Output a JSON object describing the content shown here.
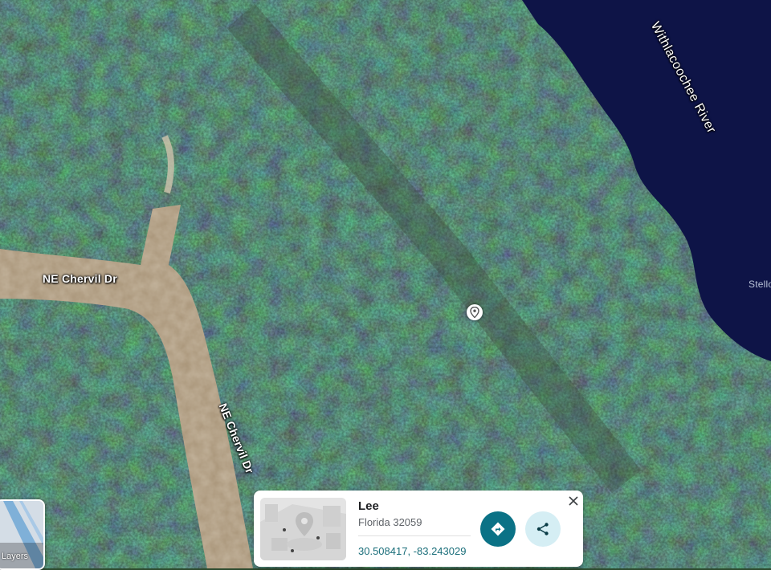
{
  "map": {
    "labels": {
      "road_horizontal": "NE Chervil Dr",
      "road_vertical": "NE Chervil Dr",
      "river": "Withlacoochee River",
      "edge_partial": "Stello"
    }
  },
  "layers_button": {
    "label": "Layers"
  },
  "place_card": {
    "title": "Lee",
    "subtitle": "Florida 32059",
    "coordinates": "30.508417, -83.243029",
    "directions_icon": "directions-icon",
    "share_icon": "share-icon",
    "close_icon": "close-icon"
  },
  "pin_icon": "location-pin-icon",
  "colors": {
    "accent": "#0b7286",
    "share_bg": "#d5eef4",
    "coords_text": "#1a6e7a",
    "river": "#0a0f3c",
    "forest": "#2f5a3a",
    "road": "#b9a58a"
  }
}
